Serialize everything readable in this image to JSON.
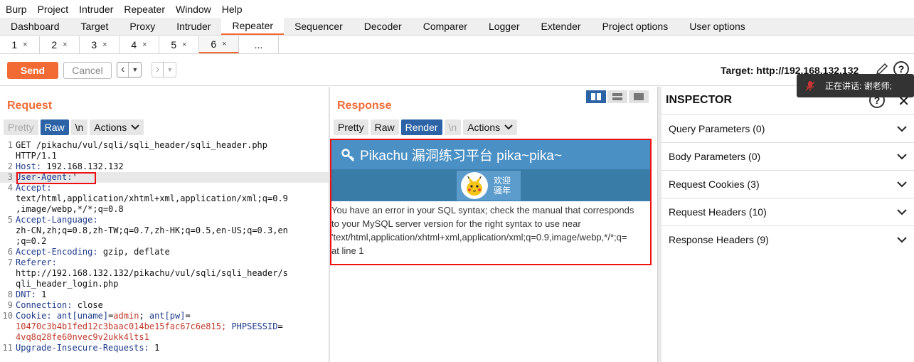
{
  "menu": [
    "Burp",
    "Project",
    "Intruder",
    "Repeater",
    "Window",
    "Help"
  ],
  "tabs": [
    "Dashboard",
    "Target",
    "Proxy",
    "Intruder",
    "Repeater",
    "Sequencer",
    "Decoder",
    "Comparer",
    "Logger",
    "Extender",
    "Project options",
    "User options"
  ],
  "active_tab": "Repeater",
  "subtabs": [
    {
      "label": "1",
      "close": "×"
    },
    {
      "label": "2",
      "close": "×"
    },
    {
      "label": "3",
      "close": "×"
    },
    {
      "label": "4",
      "close": "×"
    },
    {
      "label": "5",
      "close": "×"
    },
    {
      "label": "6",
      "close": "×"
    },
    {
      "label": "...",
      "close": ""
    }
  ],
  "active_subtab": "6",
  "toolbar": {
    "send": "Send",
    "cancel": "Cancel",
    "target": "Target: http://192.168.132.132"
  },
  "speaking": {
    "text": "正在讲话: 谢老师;"
  },
  "request": {
    "title": "Request",
    "view_tabs": {
      "pretty": "Pretty",
      "raw": "Raw",
      "newline": "\\n",
      "actions": "Actions"
    },
    "lines": [
      {
        "n": "1",
        "text": "GET /pikachu/vul/sqli/sqli_header/sqli_header.php"
      },
      {
        "n": "",
        "text": "HTTP/1.1"
      },
      {
        "n": "2",
        "key": "Host",
        "value": " 192.168.132.132"
      },
      {
        "n": "3",
        "key": "User-Agent",
        "value": "'"
      },
      {
        "n": "4",
        "key": "Accept",
        "value": ""
      },
      {
        "n": "",
        "text": "text/html,application/xhtml+xml,application/xml;q=0.9"
      },
      {
        "n": "",
        "text": ",image/webp,*/*;q=0.8"
      },
      {
        "n": "5",
        "key": "Accept-Language",
        "value": ""
      },
      {
        "n": "",
        "text": "zh-CN,zh;q=0.8,zh-TW;q=0.7,zh-HK;q=0.5,en-US;q=0.3,en"
      },
      {
        "n": "",
        "text": ";q=0.2"
      },
      {
        "n": "6",
        "key": "Accept-Encoding",
        "value": " gzip, deflate"
      },
      {
        "n": "7",
        "key": "Referer",
        "value": ""
      },
      {
        "n": "",
        "text": "http://192.168.132.132/pikachu/vul/sqli/sqli_header/s"
      },
      {
        "n": "",
        "text": "qli_header_login.php"
      },
      {
        "n": "8",
        "key": "DNT",
        "value": " 1"
      },
      {
        "n": "9",
        "key": "Connection",
        "value": " close"
      },
      {
        "n": "10",
        "cookie": true
      },
      {
        "n": "",
        "cookie_cont": "10470c3b4b1fed12c3baac014be15fac67c6e815; ",
        "cookie_key3": "PHPSESSID",
        "cookie_eq3": "="
      },
      {
        "n": "",
        "cookie_val3": "4vq8q28fe60nvec9v2ukk4lts1"
      },
      {
        "n": "11",
        "key": "Upgrade-Insecure-Requests",
        "value": " 1"
      }
    ],
    "cookie": {
      "label": "Cookie",
      "k1": "ant[uname]",
      "v1": "admin",
      "k2": "ant[pw]"
    }
  },
  "response": {
    "title": "Response",
    "view_tabs": {
      "pretty": "Pretty",
      "raw": "Raw",
      "render": "Render",
      "newline": "\\n",
      "actions": "Actions"
    },
    "page_title": "Pikachu 漏洞练习平台 pika~pika~",
    "welcome_1": "欢迎",
    "welcome_2": "骚年",
    "error_lines": [
      "You have an error in your SQL syntax; check the manual that corresponds",
      "to your MySQL server version for the right syntax to use near",
      "'text/html,application/xhtml+xml,application/xml;q=0.9,image/webp,*/*;q=",
      "at line 1"
    ]
  },
  "inspector": {
    "title": "INSPECTOR",
    "sections": [
      {
        "label": "Query Parameters (0)"
      },
      {
        "label": "Body Parameters (0)"
      },
      {
        "label": "Request Cookies (3)"
      },
      {
        "label": "Request Headers (10)"
      },
      {
        "label": "Response Headers (9)"
      }
    ]
  },
  "colors": {
    "accent": "#f26b35",
    "selected": "#2b63a6",
    "highlight_box": "#e11111"
  }
}
